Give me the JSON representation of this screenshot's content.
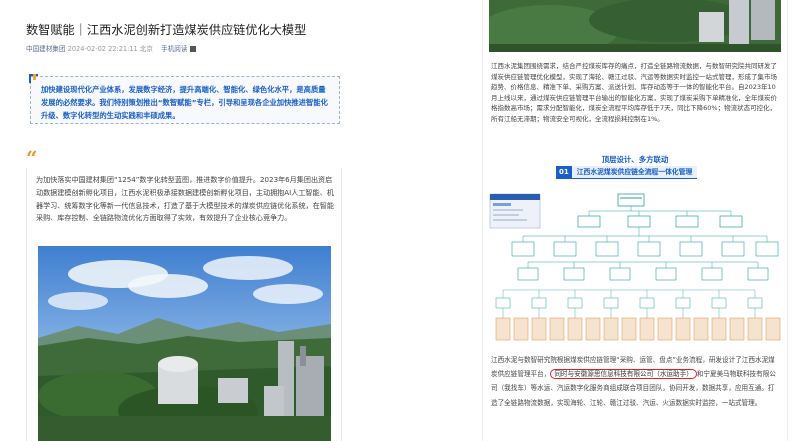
{
  "article": {
    "title": "数智赋能｜江西水泥创新打造煤炭供应链优化大模型",
    "source": "中国建材集团",
    "datetime": "2024-02-02 22:21:11 北京",
    "read_label": "手机阅读"
  },
  "callout": {
    "text": "加快建设现代化产业体系，发展数字经济，提升高端化、智能化、绿色化水平，是高质量发展的必然要求。我们特别策划推出“数智赋能”专栏，引导和呈现各企业加快推进智能化升级、数字化转型的生动实践和丰硕成果。"
  },
  "quote_icon": "quote-icon",
  "body": {
    "para1": "为加快落实中国建材集团“1254”数字化转型蓝图，推进数字价值提升。2023年6月集团出资启动数据建模创新孵化项目，江西水泥积极承接数据建模创新孵化项目，主动拥抱AI人工智能、机器学习、统筹数字化等新一代信息技术，打造了基于大模型技术的煤炭供应链优化系统，在智能采购、库存控制、全链路物流优化方面取得了实效，有效提升了企业核心竞争力。"
  },
  "right": {
    "para1": "江西水泥集团围绕需求，结合严控煤炭库存的痛点，打造全链路物流数据，与数智研究院共同研发了煤炭供应链管理优化模型，实现了海轮、赣江过驳、汽运等数据实时监控一站式管理，形成了集市场趋势、价格信息、精准下单、采购方案、派送计划、库存动态等于一体的智能化平台。自2023年10月上线以来，通过煤炭供应链管理平台输出的智能化方案，实现了煤炭采购下单精准化，全年煤炭价格指数高市场；需求分配智能化，煤炭全流程平均库存低于7天，同比下降60%；物流状态可控化，所有江船无滞期；物流安全可视化，全流程损耗控制在1%。",
    "diagram_heading": "顶层设计、多方联动",
    "diagram_num": "01",
    "diagram_title": "江西水泥煤炭供应链全流程一体化管理",
    "para2_pre": "江西水泥与数智研究院根据煤炭供应链管理“采购、运管、盘点”业务流程，研发设计了江西水泥煤炭供应链管理平台，",
    "para2_hl": "同时与安徽源思信息科技有限公司（水运助手）",
    "para2_post": "和宁夏美马物联科技有限公司（我找车）等水运、汽运数字化服务商组成联合项目团队，协同开发，数据共享，应用互通。打造了全链路物流数据，实现海轮、江轮、赣江过驳、汽运、火运数据实时监控，一站式管理。"
  },
  "colors": {
    "accent_blue": "#1a5fc9",
    "quote_orange": "#e89b2a",
    "highlight_red": "#e02020",
    "meta_link": "#576b95"
  }
}
